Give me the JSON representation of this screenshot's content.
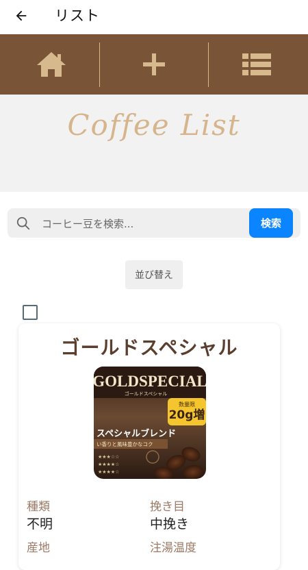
{
  "appbar": {
    "title": "リスト",
    "back_icon": "arrow-left-icon"
  },
  "nav": {
    "background": "#795437",
    "items": [
      {
        "icon": "home-icon"
      },
      {
        "icon": "plus-icon"
      },
      {
        "icon": "list-icon"
      }
    ]
  },
  "banner": {
    "title": "Coffee List"
  },
  "search": {
    "placeholder": "コーヒー豆を検索...",
    "value": "",
    "button_label": "検索"
  },
  "sort": {
    "label": "並び替え"
  },
  "card": {
    "title": "ゴールドスペシャル",
    "image": {
      "brand_text": "GOLDSPECIAL",
      "sub_text": "ゴールドスペシャル",
      "badge_text": "20g増",
      "badge_note": "数量限",
      "blend_text": "スペシャルブレンド",
      "tagline": "い香りと風味豊かなコク"
    },
    "details": [
      {
        "label": "種類",
        "value": "不明"
      },
      {
        "label": "挽き目",
        "value": "中挽き"
      },
      {
        "label": "産地",
        "value": ""
      },
      {
        "label": "注湯温度",
        "value": ""
      }
    ]
  }
}
